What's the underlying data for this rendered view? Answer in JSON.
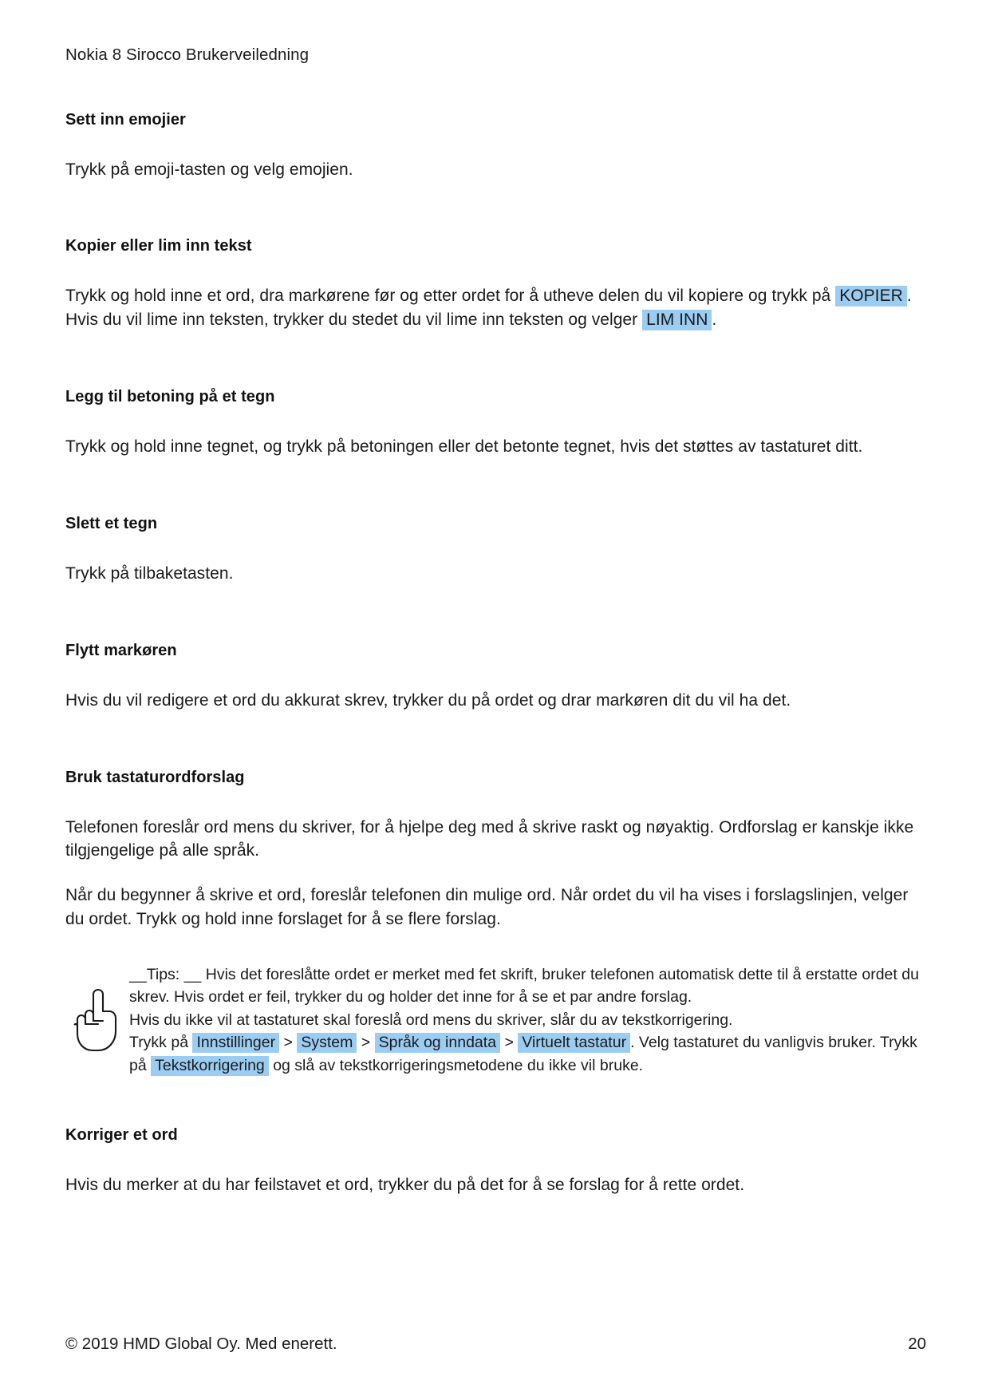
{
  "document": {
    "header": "Nokia 8 Sirocco Brukerveiledning",
    "highlight_color": "#9bcdf3"
  },
  "sections": [
    {
      "heading": "Sett inn emojier",
      "paragraph": "Trykk på emoji-tasten og velg emojien."
    },
    {
      "heading": "Kopier eller lim inn tekst",
      "text_1": "Trykk og hold inne et ord, dra markørene før og etter ordet for å utheve delen du vil kopiere og trykk på",
      "chip_1": "KOPIER",
      "text_2": ". Hvis du vil lime inn teksten, trykker du stedet du vil lime inn teksten og velger",
      "chip_2": "LIM INN",
      "text_3": "."
    },
    {
      "heading": "Legg til betoning på et tegn",
      "paragraph": "Trykk og hold inne tegnet, og trykk på betoningen eller det betonte tegnet, hvis det støttes av tastaturet ditt."
    },
    {
      "heading": "Slett et tegn",
      "paragraph": "Trykk på tilbaketasten."
    },
    {
      "heading": "Flytt markøren",
      "paragraph": "Hvis du vil redigere et ord du akkurat skrev, trykker du på ordet og drar markøren dit du vil ha det."
    },
    {
      "heading": "Bruk tastaturordforslag",
      "paragraph_1": "Telefonen foreslår ord mens du skriver, for å hjelpe deg med å skrive raskt og nøyaktig. Ordforslag er kanskje ikke tilgjengelige på alle språk.",
      "paragraph_2": "Når du begynner å skrive et ord, foreslår telefonen din mulige ord. Når ordet du vil ha vises i forslagslinjen, velger du ordet. Trykk og hold inne forslaget for å se flere forslag."
    },
    {
      "heading": "Korriger et ord",
      "paragraph": "Hvis du merker at du har feilstavet et ord, trykker du på det for å se forslag for å rette ordet."
    }
  ],
  "tip": {
    "icon": "pointing-hand-icon",
    "line_1": "__Tips: __ Hvis det foreslåtte ordet er merket med fet skrift, bruker telefonen automatisk dette til å erstatte ordet du skrev. Hvis ordet er feil, trykker du og holder det inne for å se et par andre forslag.",
    "line_2": "Hvis du ikke vil at tastaturet skal foreslå ord mens du skriver, slår du av tekstkorrigering.",
    "line_3_prefix": "Trykk på",
    "breadcrumb": [
      "Innstillinger",
      "System",
      "Språk og inndata",
      "Virtuelt tastatur"
    ],
    "breadcrumb_separator": ">",
    "line_3_middle": ". Velg tastaturet du vanligvis bruker. Trykk på",
    "chip_tekstkorrigering": "Tekstkorrigering",
    "line_3_suffix": "og slå av tekstkorrigeringsmetodene du ikke vil bruke."
  },
  "footer": {
    "copyright": "© 2019 HMD Global Oy. Med enerett.",
    "page_number": "20"
  }
}
